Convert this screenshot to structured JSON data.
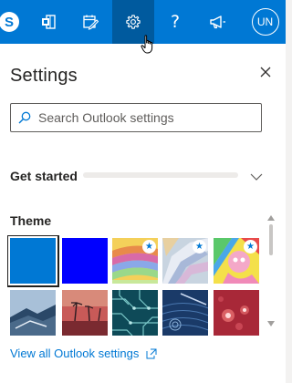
{
  "topbar": {
    "skype_letter": "S",
    "help_glyph": "?",
    "avatar_initials": "UN",
    "icons": [
      "skype-icon",
      "office-icon",
      "todo-icon",
      "gear-icon",
      "help-icon",
      "megaphone-icon"
    ],
    "active_icon": "gear-icon",
    "bg_color": "#0078d4",
    "active_color": "#005a9e"
  },
  "panel": {
    "title": "Settings",
    "search_placeholder": "Search Outlook settings",
    "get_started_label": "Get started",
    "get_started_progress": 0,
    "theme_label": "Theme",
    "view_all_label": "View all Outlook settings"
  },
  "themes": [
    {
      "name": "blue",
      "color": "#0078d4",
      "selected": true,
      "starred": false
    },
    {
      "name": "dark-blue",
      "color": "#0000ff",
      "selected": false,
      "starred": false
    },
    {
      "name": "rainbow",
      "color": "#e8c04a",
      "selected": false,
      "starred": true
    },
    {
      "name": "unicorn",
      "color": "#b8c8d8",
      "selected": false,
      "starred": true
    },
    {
      "name": "pink-cartoon",
      "color": "#f08aa8",
      "selected": false,
      "starred": true
    },
    {
      "name": "mountain",
      "color": "#6a8aa8",
      "selected": false,
      "starred": false
    },
    {
      "name": "palms",
      "color": "#a04848",
      "selected": false,
      "starred": false
    },
    {
      "name": "circuit",
      "color": "#1a6a6a",
      "selected": false,
      "starred": false
    },
    {
      "name": "elevation",
      "color": "#1a3a6a",
      "selected": false,
      "starred": false
    },
    {
      "name": "lights",
      "color": "#b83848",
      "selected": false,
      "starred": false
    }
  ]
}
